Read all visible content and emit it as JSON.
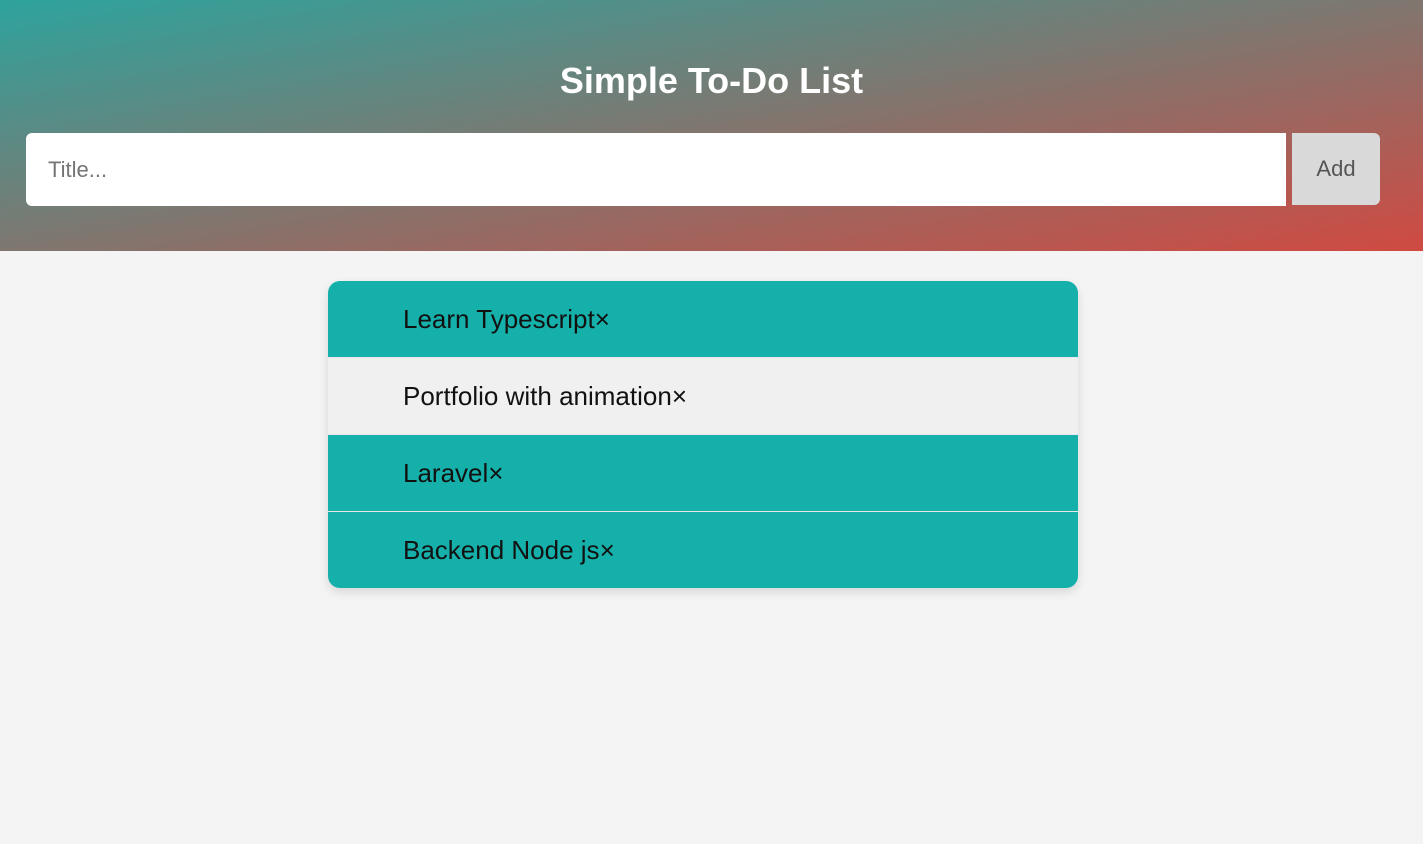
{
  "header": {
    "title": "Simple To-Do List",
    "input_placeholder": "Title...",
    "add_label": "Add"
  },
  "colors": {
    "gradient_start": "#2ea39d",
    "gradient_end": "#d04a42",
    "item_teal": "#16b0aa",
    "item_light": "#f0f0f0",
    "page_background": "#f4f4f4"
  },
  "todos": [
    {
      "label": "Learn Typescript",
      "close": "×",
      "variant": "teal"
    },
    {
      "label": "Portfolio with animation",
      "close": "×",
      "variant": "light"
    },
    {
      "label": "Laravel",
      "close": "×",
      "variant": "teal"
    },
    {
      "label": "Backend Node js",
      "close": "×",
      "variant": "teal"
    }
  ]
}
